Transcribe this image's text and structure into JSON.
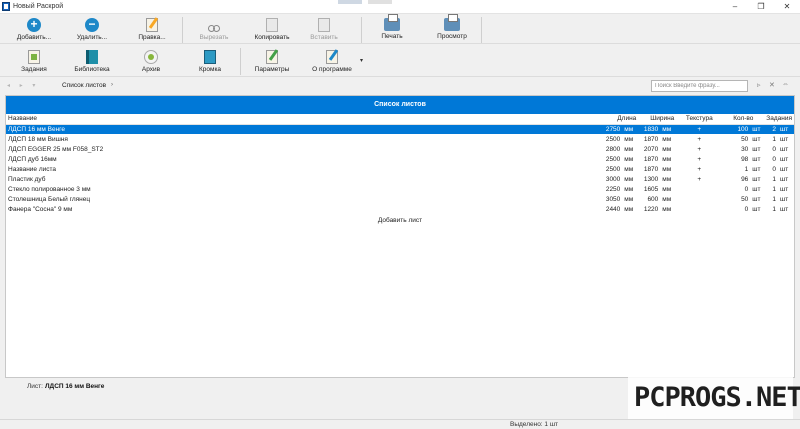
{
  "window": {
    "title": "Новый Раскрой",
    "minimize": "–",
    "maximize": "❐",
    "close": "✕"
  },
  "toolbar_main": {
    "add": "Добавить...",
    "delete": "Удалить...",
    "edit": "Правка...",
    "cut": "Вырезать",
    "copy": "Копировать",
    "paste": "Вставить",
    "print": "Печать",
    "preview": "Просмотр"
  },
  "toolbar_secondary": {
    "tasks": "Задания",
    "library": "Библиотека",
    "archive": "Архив",
    "edging": "Кромка",
    "settings": "Параметры",
    "about": "О программе",
    "more": "▾"
  },
  "nav": {
    "back_forward": "◂ ▸ ▾",
    "breadcrumb": "Список листов",
    "breadcrumb_chevron": "›",
    "search_placeholder": "Поиск Введите фразу...",
    "search_next": "▹",
    "search_clear": "✕",
    "search_options": "⇔"
  },
  "panel": {
    "title": "Список листов",
    "columns": {
      "name": "Название",
      "length": "Длина",
      "width": "Ширина",
      "texture": "Текстура",
      "quantity": "Кол-во",
      "tasks": "Задания"
    },
    "rows": [
      {
        "name": "ЛДСП 16 мм Венге",
        "length": "2750",
        "length_unit": "мм",
        "width": "1830",
        "width_unit": "мм",
        "texture": "+",
        "quantity": "100",
        "quantity_unit": "шт",
        "tasks": "2",
        "tasks_unit": "шт"
      },
      {
        "name": "ЛДСП 18 мм Вишня",
        "length": "2500",
        "length_unit": "мм",
        "width": "1870",
        "width_unit": "мм",
        "texture": "+",
        "quantity": "50",
        "quantity_unit": "шт",
        "tasks": "1",
        "tasks_unit": "шт"
      },
      {
        "name": "ЛДСП EGGER 25 мм F058_ST2",
        "length": "2800",
        "length_unit": "мм",
        "width": "2070",
        "width_unit": "мм",
        "texture": "+",
        "quantity": "30",
        "quantity_unit": "шт",
        "tasks": "0",
        "tasks_unit": "шт"
      },
      {
        "name": "ЛДСП дуб 16мм",
        "length": "2500",
        "length_unit": "мм",
        "width": "1870",
        "width_unit": "мм",
        "texture": "+",
        "quantity": "98",
        "quantity_unit": "шт",
        "tasks": "0",
        "tasks_unit": "шт"
      },
      {
        "name": "Название листа",
        "length": "2500",
        "length_unit": "мм",
        "width": "1870",
        "width_unit": "мм",
        "texture": "+",
        "quantity": "1",
        "quantity_unit": "шт",
        "tasks": "0",
        "tasks_unit": "шт"
      },
      {
        "name": "Пластик дуб",
        "length": "3000",
        "length_unit": "мм",
        "width": "1300",
        "width_unit": "мм",
        "texture": "+",
        "quantity": "96",
        "quantity_unit": "шт",
        "tasks": "1",
        "tasks_unit": "шт"
      },
      {
        "name": "Стекло полированное 3 мм",
        "length": "2250",
        "length_unit": "мм",
        "width": "1605",
        "width_unit": "мм",
        "texture": "",
        "quantity": "0",
        "quantity_unit": "шт",
        "tasks": "1",
        "tasks_unit": "шт"
      },
      {
        "name": "Столешница Белый глянец",
        "length": "3050",
        "length_unit": "мм",
        "width": "600",
        "width_unit": "мм",
        "texture": "",
        "quantity": "50",
        "quantity_unit": "шт",
        "tasks": "1",
        "tasks_unit": "шт"
      },
      {
        "name": "Фанера \"Сосна\" 9 мм",
        "length": "2440",
        "length_unit": "мм",
        "width": "1220",
        "width_unit": "мм",
        "texture": "",
        "quantity": "0",
        "quantity_unit": "шт",
        "tasks": "1",
        "tasks_unit": "шт"
      }
    ],
    "add_sheet": "Добавить лист"
  },
  "footer": {
    "sheet_label": "Лист:",
    "sheet_value": "ЛДСП 16 мм Венге"
  },
  "status": {
    "selected": "Выделено: 1 шт"
  },
  "watermark": {
    "text": "PCPROGS.NET"
  }
}
